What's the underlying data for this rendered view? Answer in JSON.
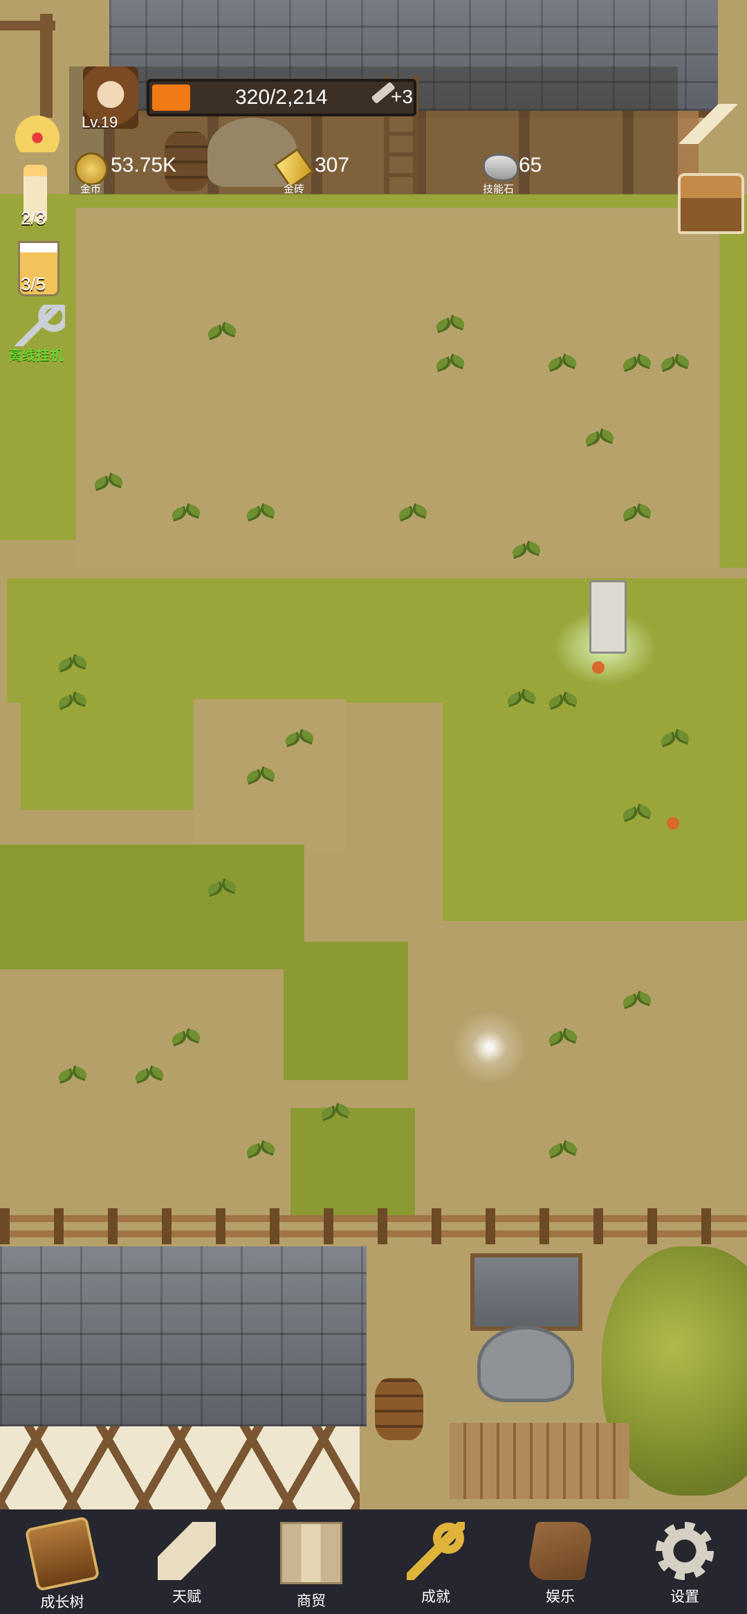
{
  "player": {
    "level": "Lv.19"
  },
  "xp": {
    "text": "320/2,214",
    "bonus": "+3",
    "progress": 0.145
  },
  "resources": [
    {
      "icon": "gold-coin-icon",
      "value": "53.75K",
      "label": "金币"
    },
    {
      "icon": "gold-bar-icon",
      "value": "307",
      "label": "金砖"
    },
    {
      "icon": "skill-stone-icon",
      "value": "65",
      "label": "技能石"
    }
  ],
  "side": {
    "candle_count": "2/3",
    "drink_count": "3/5",
    "idle_label": "离线挂机"
  },
  "nav": [
    {
      "label": "成长树",
      "icon": "growth-tree-book-icon"
    },
    {
      "label": "天赋",
      "icon": "talent-scroll-icon"
    },
    {
      "label": "商贸",
      "icon": "trade-map-icon"
    },
    {
      "label": "成就",
      "icon": "achievement-key-icon"
    },
    {
      "label": "娱乐",
      "icon": "entertainment-cloth-icon"
    },
    {
      "label": "设置",
      "icon": "settings-gear-icon"
    }
  ],
  "colors": {
    "xp_fill": "#f07a14",
    "idle_text": "#5df02a",
    "nav_bg": "#26262e"
  }
}
